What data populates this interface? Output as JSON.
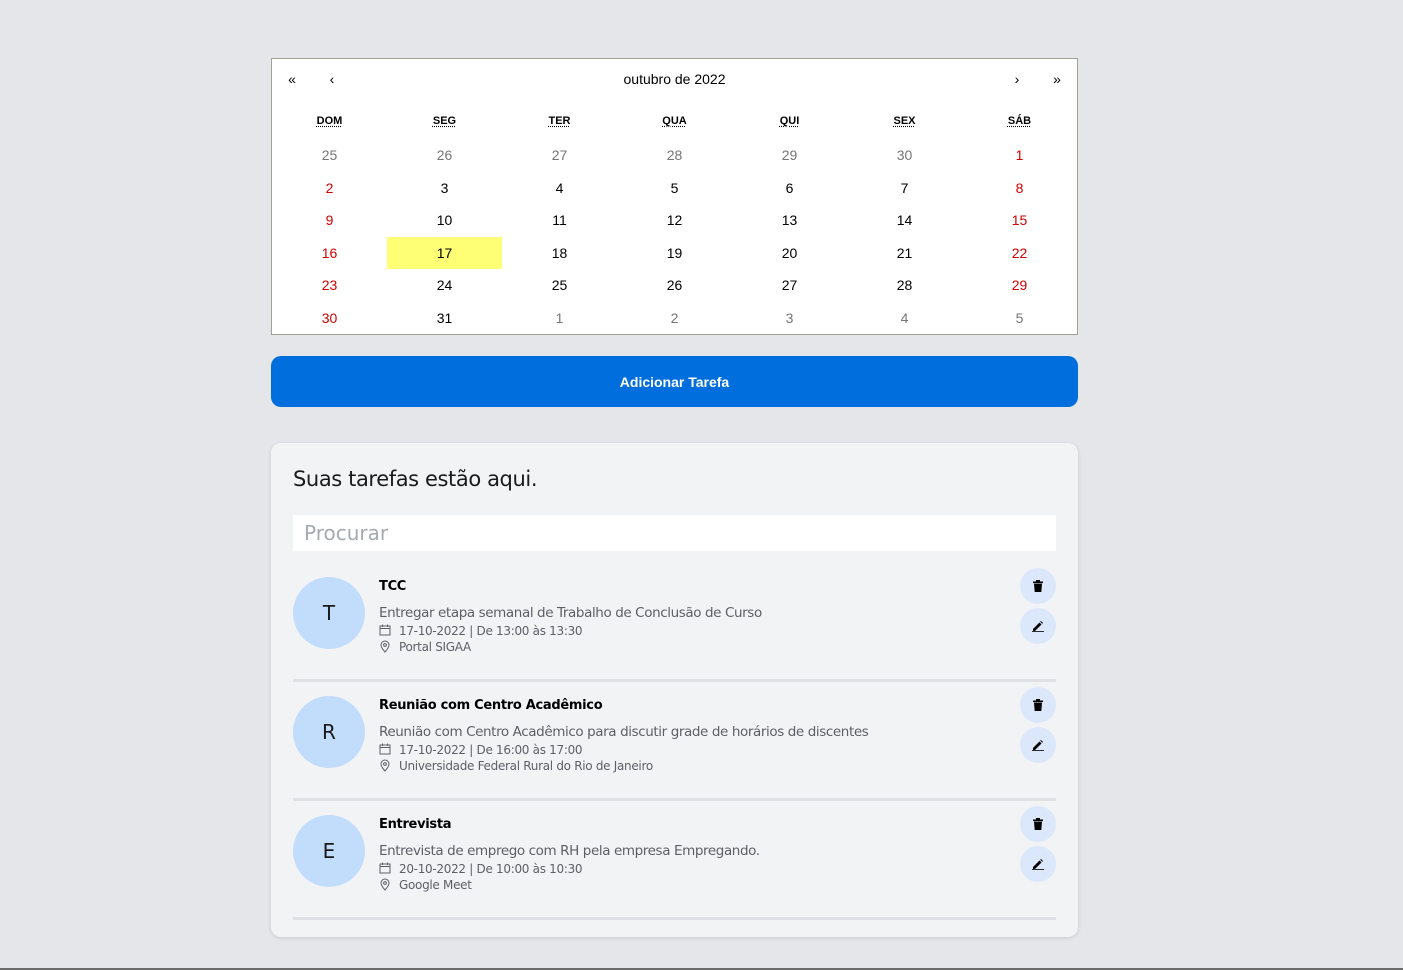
{
  "calendar": {
    "nav": {
      "prev2": "«",
      "prev": "‹",
      "next": "›",
      "next2": "»"
    },
    "month_label": "outubro de 2022",
    "weekdays": [
      "DOM",
      "SEG",
      "TER",
      "QUA",
      "QUI",
      "SEX",
      "SÁB"
    ],
    "days": [
      {
        "n": "25",
        "other": true,
        "weekend": false
      },
      {
        "n": "26",
        "other": true,
        "weekend": false
      },
      {
        "n": "27",
        "other": true,
        "weekend": false
      },
      {
        "n": "28",
        "other": true,
        "weekend": false
      },
      {
        "n": "29",
        "other": true,
        "weekend": false
      },
      {
        "n": "30",
        "other": true,
        "weekend": false
      },
      {
        "n": "1",
        "other": false,
        "weekend": true
      },
      {
        "n": "2",
        "other": false,
        "weekend": true
      },
      {
        "n": "3",
        "other": false,
        "weekend": false
      },
      {
        "n": "4",
        "other": false,
        "weekend": false
      },
      {
        "n": "5",
        "other": false,
        "weekend": false
      },
      {
        "n": "6",
        "other": false,
        "weekend": false
      },
      {
        "n": "7",
        "other": false,
        "weekend": false
      },
      {
        "n": "8",
        "other": false,
        "weekend": true
      },
      {
        "n": "9",
        "other": false,
        "weekend": true
      },
      {
        "n": "10",
        "other": false,
        "weekend": false
      },
      {
        "n": "11",
        "other": false,
        "weekend": false
      },
      {
        "n": "12",
        "other": false,
        "weekend": false
      },
      {
        "n": "13",
        "other": false,
        "weekend": false
      },
      {
        "n": "14",
        "other": false,
        "weekend": false
      },
      {
        "n": "15",
        "other": false,
        "weekend": true
      },
      {
        "n": "16",
        "other": false,
        "weekend": true
      },
      {
        "n": "17",
        "other": false,
        "weekend": false,
        "today": true
      },
      {
        "n": "18",
        "other": false,
        "weekend": false
      },
      {
        "n": "19",
        "other": false,
        "weekend": false
      },
      {
        "n": "20",
        "other": false,
        "weekend": false
      },
      {
        "n": "21",
        "other": false,
        "weekend": false
      },
      {
        "n": "22",
        "other": false,
        "weekend": true
      },
      {
        "n": "23",
        "other": false,
        "weekend": true
      },
      {
        "n": "24",
        "other": false,
        "weekend": false
      },
      {
        "n": "25",
        "other": false,
        "weekend": false
      },
      {
        "n": "26",
        "other": false,
        "weekend": false
      },
      {
        "n": "27",
        "other": false,
        "weekend": false
      },
      {
        "n": "28",
        "other": false,
        "weekend": false
      },
      {
        "n": "29",
        "other": false,
        "weekend": true
      },
      {
        "n": "30",
        "other": false,
        "weekend": true
      },
      {
        "n": "31",
        "other": false,
        "weekend": false
      },
      {
        "n": "1",
        "other": true,
        "weekend": false
      },
      {
        "n": "2",
        "other": true,
        "weekend": false
      },
      {
        "n": "3",
        "other": true,
        "weekend": false
      },
      {
        "n": "4",
        "other": true,
        "weekend": false
      },
      {
        "n": "5",
        "other": true,
        "weekend": false
      }
    ]
  },
  "add_button": {
    "label": "Adicionar Tarefa"
  },
  "tasks_panel": {
    "title": "Suas tarefas estão aqui.",
    "search_placeholder": "Procurar",
    "items": [
      {
        "initial": "T",
        "title": "TCC",
        "description": "Entregar etapa semanal de Trabalho de Conclusão de Curso",
        "datetime": "17-10-2022 | De 13:00 às 13:30",
        "location": "Portal SIGAA"
      },
      {
        "initial": "R",
        "title": "Reunião com Centro Acadêmico",
        "description": "Reunião com Centro Acadêmico para discutir grade de horários de discentes",
        "datetime": "17-10-2022 | De 16:00 às 17:00",
        "location": "Universidade Federal Rural do Rio de Janeiro"
      },
      {
        "initial": "E",
        "title": "Entrevista",
        "description": "Entrevista de emprego com RH pela empresa Empregando.",
        "datetime": "20-10-2022 | De 10:00 às 10:30",
        "location": "Google Meet"
      }
    ]
  },
  "colors": {
    "accent": "#006edc",
    "weekend": "#d10000",
    "today_highlight": "#ffff76",
    "avatar_bg": "#c2dcfc",
    "icon_button_bg": "#dbe8fb"
  }
}
